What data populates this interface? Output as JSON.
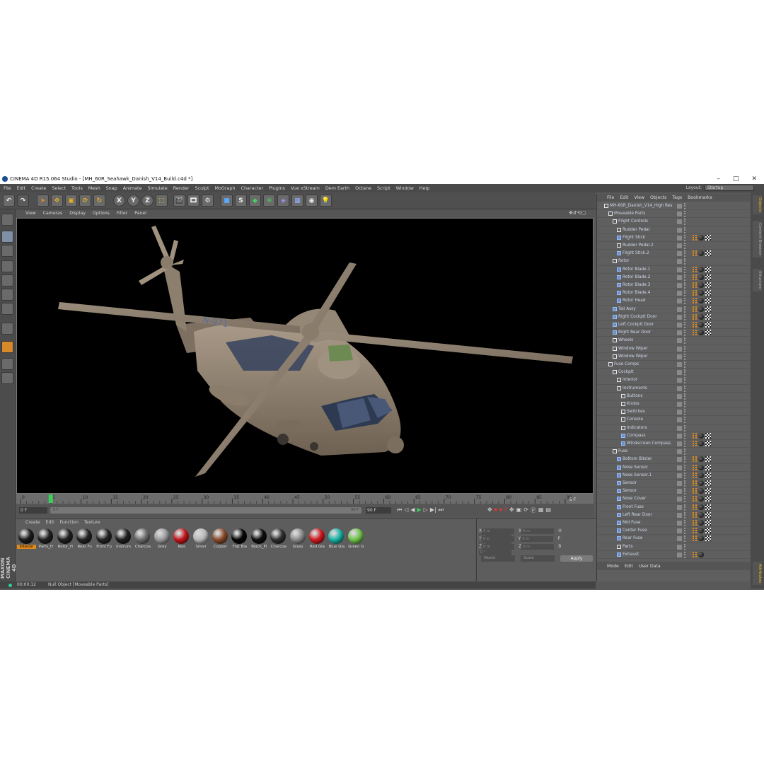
{
  "window": {
    "title": "CINEMA 4D R15.064 Studio - [MH_60R_Seahawk_Danish_V14_Build.c4d *]",
    "minimize": "–",
    "maximize": "□",
    "close": "✕"
  },
  "menubar": [
    "File",
    "Edit",
    "Create",
    "Select",
    "Tools",
    "Mesh",
    "Snap",
    "Animate",
    "Simulate",
    "Render",
    "Sculpt",
    "MoGraph",
    "Character",
    "Plugins",
    "Vue xStream",
    "Dem Earth",
    "Octane",
    "Script",
    "Window",
    "Help"
  ],
  "layout": {
    "label": "Layout:",
    "value": "Startup"
  },
  "toolbar": {
    "axis_x": "X",
    "axis_y": "Y",
    "axis_z": "Z"
  },
  "viewport_menu": [
    "View",
    "Cameras",
    "Display",
    "Options",
    "Filter",
    "Panel"
  ],
  "timeline": {
    "ticks": [
      "0",
      "5",
      "10",
      "15",
      "20",
      "25",
      "30",
      "35",
      "40",
      "45",
      "50",
      "55",
      "60",
      "65",
      "70",
      "75",
      "80",
      "85",
      "90"
    ],
    "current_frame": "5 F",
    "start": "0 F",
    "min_slider": "0 F",
    "max_slider": "90 F",
    "end_a": "90 F",
    "end_b": "90 F"
  },
  "materials": {
    "menu": [
      "Create",
      "Edit",
      "Function",
      "Texture"
    ],
    "items": [
      {
        "label": "Interior",
        "color": "#1b1b1b"
      },
      {
        "label": "Parts_H",
        "color": "#202020"
      },
      {
        "label": "Rotor_H",
        "color": "#202020"
      },
      {
        "label": "Rear Fu",
        "color": "#232323"
      },
      {
        "label": "Front Fu",
        "color": "#232323"
      },
      {
        "label": "Instrum",
        "color": "#1e1e1e"
      },
      {
        "label": "Charcoa",
        "color": "#6d6d6d"
      },
      {
        "label": "Grey",
        "color": "#9a9a9a"
      },
      {
        "label": "Red",
        "color": "#c4161c"
      },
      {
        "label": "Silver",
        "color": "#b7b7b7"
      },
      {
        "label": "Copper",
        "color": "#8a4a2a"
      },
      {
        "label": "Flat Bla",
        "color": "#050505"
      },
      {
        "label": "Black_Pl",
        "color": "#0d0d0d"
      },
      {
        "label": "Charcoa",
        "color": "#2e2e2e"
      },
      {
        "label": "Glass",
        "color": "#8a8a8a"
      },
      {
        "label": "Red Gla",
        "color": "#d01a20"
      },
      {
        "label": "Blue Gla",
        "color": "#17b3a6"
      },
      {
        "label": "Green G",
        "color": "#6fc24a"
      }
    ]
  },
  "coords": {
    "rows": [
      {
        "a": "X",
        "av": "0 m",
        "b": "X",
        "bv": "0 m",
        "c": "H",
        "cv": "0 °"
      },
      {
        "a": "Y",
        "av": "0 m",
        "b": "Y",
        "bv": "0 m",
        "c": "P",
        "cv": "0 °"
      },
      {
        "a": "Z",
        "av": "0 m",
        "b": "Z",
        "bv": "0 m",
        "c": "B",
        "cv": "0 °"
      }
    ],
    "mode1": "World",
    "mode2": "Scale",
    "apply": "Apply"
  },
  "brand": "MAXON CINEMA 4D",
  "status": {
    "time": "00:00:12",
    "message": "Null Object [Moveable Parts]"
  },
  "objects": {
    "menu": [
      "File",
      "Edit",
      "View",
      "Objects",
      "Tags",
      "Bookmarks"
    ],
    "attr_menu": [
      "Mode",
      "Edit",
      "User Data"
    ],
    "tree": [
      {
        "name": "MH-60R_Danish_V14_High Res",
        "indent": 0,
        "tags": ""
      },
      {
        "name": "Moveable Parts",
        "indent": 1,
        "tags": ""
      },
      {
        "name": "Flight Controls",
        "indent": 2,
        "tags": ""
      },
      {
        "name": "Rudder Pedal",
        "indent": 3,
        "tags": ""
      },
      {
        "name": "Flight Stick",
        "indent": 3,
        "tags": "obc"
      },
      {
        "name": "Rudder Pedal.2",
        "indent": 3,
        "tags": ""
      },
      {
        "name": "Flight Stick.2",
        "indent": 3,
        "tags": "obc"
      },
      {
        "name": "Rotor",
        "indent": 2,
        "tags": ""
      },
      {
        "name": "Rotor Blade.1",
        "indent": 3,
        "tags": "obc"
      },
      {
        "name": "Rotor Blade.2",
        "indent": 3,
        "tags": "obc"
      },
      {
        "name": "Rotor Blade.3",
        "indent": 3,
        "tags": "obc"
      },
      {
        "name": "Rotor Blade.4",
        "indent": 3,
        "tags": "obc"
      },
      {
        "name": "Rotor Head",
        "indent": 3,
        "tags": "obc"
      },
      {
        "name": "Tail Assy",
        "indent": 2,
        "tags": "obc"
      },
      {
        "name": "Right Cockpit Door",
        "indent": 2,
        "tags": "obc"
      },
      {
        "name": "Left Cockpit Door",
        "indent": 2,
        "tags": "obc"
      },
      {
        "name": "Right Rear Door",
        "indent": 2,
        "tags": "obc"
      },
      {
        "name": "Wheels",
        "indent": 2,
        "tags": ""
      },
      {
        "name": "Window Wiper",
        "indent": 2,
        "tags": ""
      },
      {
        "name": "Window Wiper",
        "indent": 2,
        "tags": ""
      },
      {
        "name": "Fuse Comps",
        "indent": 1,
        "tags": ""
      },
      {
        "name": "Cockpit",
        "indent": 2,
        "tags": ""
      },
      {
        "name": "Interior",
        "indent": 3,
        "tags": ""
      },
      {
        "name": "Instruments",
        "indent": 3,
        "tags": ""
      },
      {
        "name": "Buttons",
        "indent": 4,
        "tags": ""
      },
      {
        "name": "Knobs",
        "indent": 4,
        "tags": ""
      },
      {
        "name": "Switches",
        "indent": 4,
        "tags": ""
      },
      {
        "name": "Console",
        "indent": 4,
        "tags": ""
      },
      {
        "name": "Indicators",
        "indent": 4,
        "tags": ""
      },
      {
        "name": "Compass",
        "indent": 4,
        "tags": "obc"
      },
      {
        "name": "Windscreen Compass",
        "indent": 4,
        "tags": "obc"
      },
      {
        "name": "Fuse",
        "indent": 2,
        "tags": ""
      },
      {
        "name": "Bottom Blister",
        "indent": 3,
        "tags": "obc"
      },
      {
        "name": "Nose Sensor",
        "indent": 3,
        "tags": "obc"
      },
      {
        "name": "Nose Sensor.1",
        "indent": 3,
        "tags": "obc"
      },
      {
        "name": "Sensor",
        "indent": 3,
        "tags": "obc"
      },
      {
        "name": "Sensor",
        "indent": 3,
        "tags": "obc"
      },
      {
        "name": "Nose Cover",
        "indent": 3,
        "tags": "obc"
      },
      {
        "name": "Front Fuse",
        "indent": 3,
        "tags": "obc"
      },
      {
        "name": "Left Rear Door",
        "indent": 3,
        "tags": "obc"
      },
      {
        "name": "Mid Fuse",
        "indent": 3,
        "tags": "obc"
      },
      {
        "name": "Center Fuse",
        "indent": 3,
        "tags": "obc"
      },
      {
        "name": "Rear Fuse",
        "indent": 3,
        "tags": "obc"
      },
      {
        "name": "Parts",
        "indent": 3,
        "tags": ""
      },
      {
        "name": "Exhaust",
        "indent": 3,
        "tags": "ob"
      }
    ]
  },
  "side_tabs": [
    "Objects",
    "Content Browser",
    "Structure",
    "Attributes"
  ]
}
